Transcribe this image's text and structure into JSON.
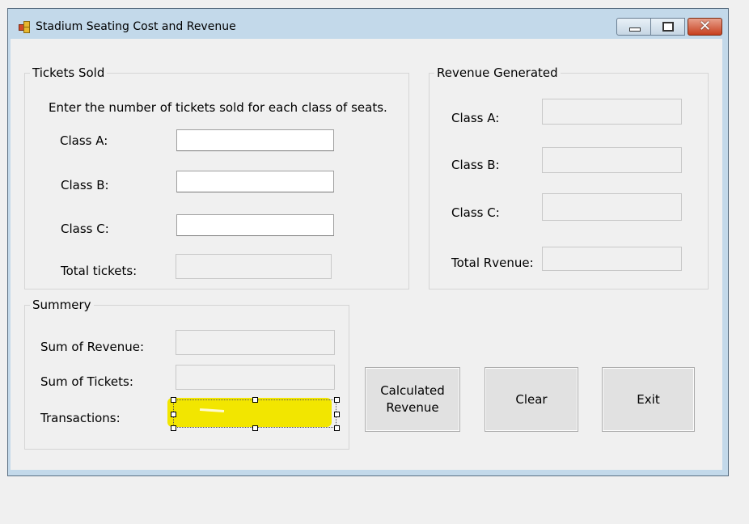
{
  "window": {
    "title": "Stadium Seating Cost and Revenue",
    "controls": {
      "minimize": "minimize",
      "maximize": "maximize",
      "close": "✕"
    }
  },
  "tickets_sold": {
    "title": "Tickets Sold",
    "instructions": "Enter the number of tickets sold for each class of seats.",
    "class_a_label": "Class A:",
    "class_b_label": "Class B:",
    "class_c_label": "Class C:",
    "total_label": "Total tickets:",
    "class_a_value": "",
    "class_b_value": "",
    "class_c_value": "",
    "total_value": ""
  },
  "revenue": {
    "title": "Revenue Generated",
    "class_a_label": "Class A:",
    "class_b_label": "Class B:",
    "class_c_label": "Class C:",
    "total_label": "Total Rvenue:",
    "class_a_value": "",
    "class_b_value": "",
    "class_c_value": "",
    "total_value": ""
  },
  "summary": {
    "title": "Summery",
    "sum_revenue_label": "Sum of Revenue:",
    "sum_tickets_label": "Sum of Tickets:",
    "transactions_label": "Transactions:",
    "sum_revenue_value": "",
    "sum_tickets_value": "",
    "transactions_value": ""
  },
  "buttons": {
    "calculate": "Calculated\nRevenue",
    "clear": "Clear",
    "exit": "Exit"
  },
  "colors": {
    "titlebar": "#c3d9ea",
    "highlight": "#f2e600",
    "close_button": "#c7401f"
  }
}
